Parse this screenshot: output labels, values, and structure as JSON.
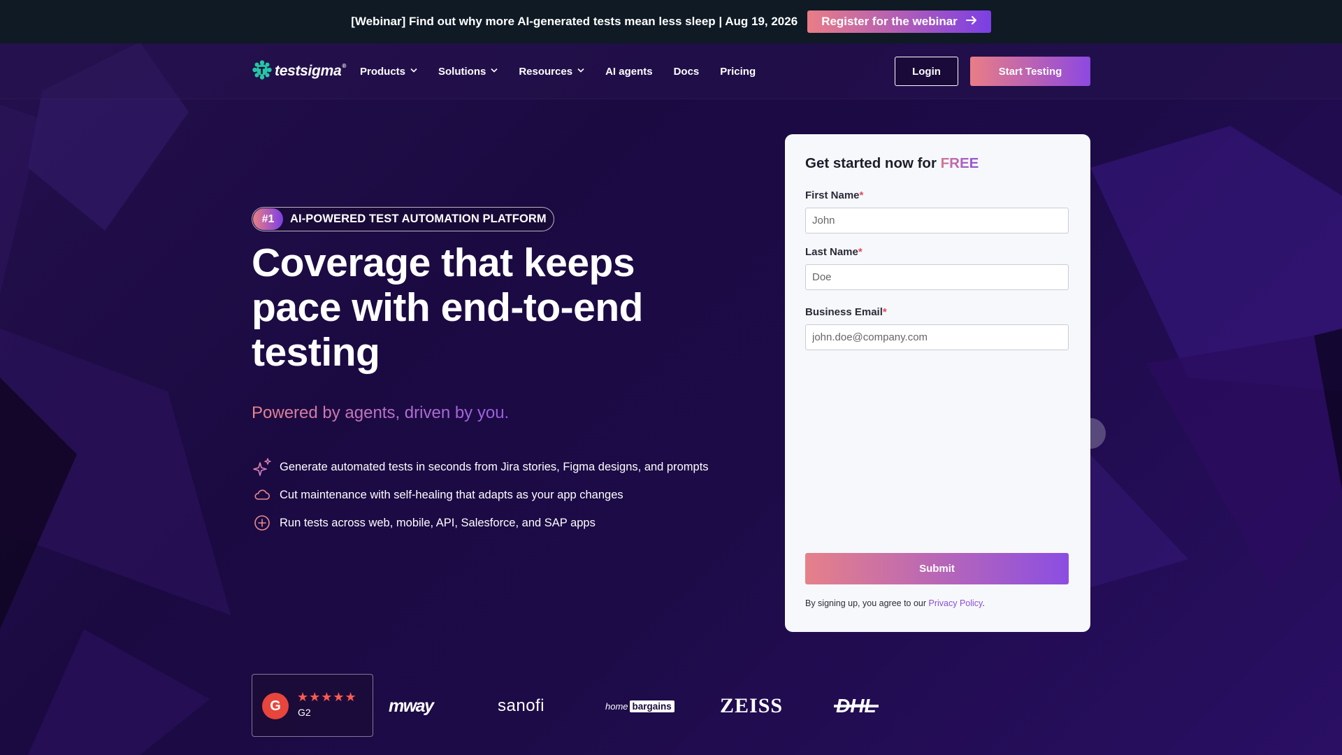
{
  "banner": {
    "text": "[Webinar] Find out why more AI-generated tests mean less sleep | Aug 19, 2026",
    "button_label": "Register for the webinar",
    "button_icon": "arrow-right-icon"
  },
  "nav": {
    "logo_text": "testsigma",
    "logo_mark": "®",
    "items": [
      {
        "label": "Products",
        "has_dropdown": true
      },
      {
        "label": "Solutions",
        "has_dropdown": true
      },
      {
        "label": "Resources",
        "has_dropdown": true
      },
      {
        "label": "AI agents",
        "has_dropdown": false
      },
      {
        "label": "Docs",
        "has_dropdown": false
      },
      {
        "label": "Pricing",
        "has_dropdown": false
      }
    ],
    "login_label": "Login",
    "start_label": "Start Testing"
  },
  "hero": {
    "badge_num": "#1",
    "badge_text": "AI-POWERED TEST AUTOMATION PLATFORM",
    "title": "Coverage that keeps pace with end-to-end testing",
    "subtitle": "Powered by agents, driven by you.",
    "features": [
      {
        "icon": "sparkle-icon",
        "text": "Generate automated tests in seconds from Jira stories, Figma designs, and prompts"
      },
      {
        "icon": "cloud-icon",
        "text": "Cut maintenance with self-healing that adapts as your app changes"
      },
      {
        "icon": "plus-circle-icon",
        "text": "Run tests across web, mobile, API, Salesforce, and SAP apps"
      }
    ]
  },
  "form": {
    "title_prefix": "Get started now for ",
    "title_highlight": "FREE",
    "first_name": {
      "label": "First Name",
      "required_mark": "*",
      "placeholder": "John",
      "value": ""
    },
    "last_name": {
      "label": "Last Name",
      "required_mark": "*",
      "placeholder": "Doe",
      "value": ""
    },
    "email": {
      "label": "Business Email",
      "required_mark": "*",
      "placeholder": "john.doe@company.com",
      "value": ""
    },
    "submit_label": "Submit",
    "terms_prefix": "By signing up, you agree to our ",
    "terms_link": "Privacy Policy",
    "terms_suffix": "."
  },
  "logos": {
    "g2_letter": "G",
    "g2_stars": "★★★★★",
    "g2_label": "G2",
    "clients": {
      "mway": "mway",
      "sanofi": "sanofi",
      "homebargains_home": "home",
      "homebargains_bargains": "bargains",
      "zeiss": "ZEISS",
      "dhl": "DHL"
    }
  },
  "colors": {
    "banner_bg": "#0f1a24",
    "accent_start": "#e97d86",
    "accent_end": "#7b3fe4",
    "page_bg": "#1a0a3a",
    "card_bg": "#f7f8fc",
    "required": "#e0485a"
  }
}
